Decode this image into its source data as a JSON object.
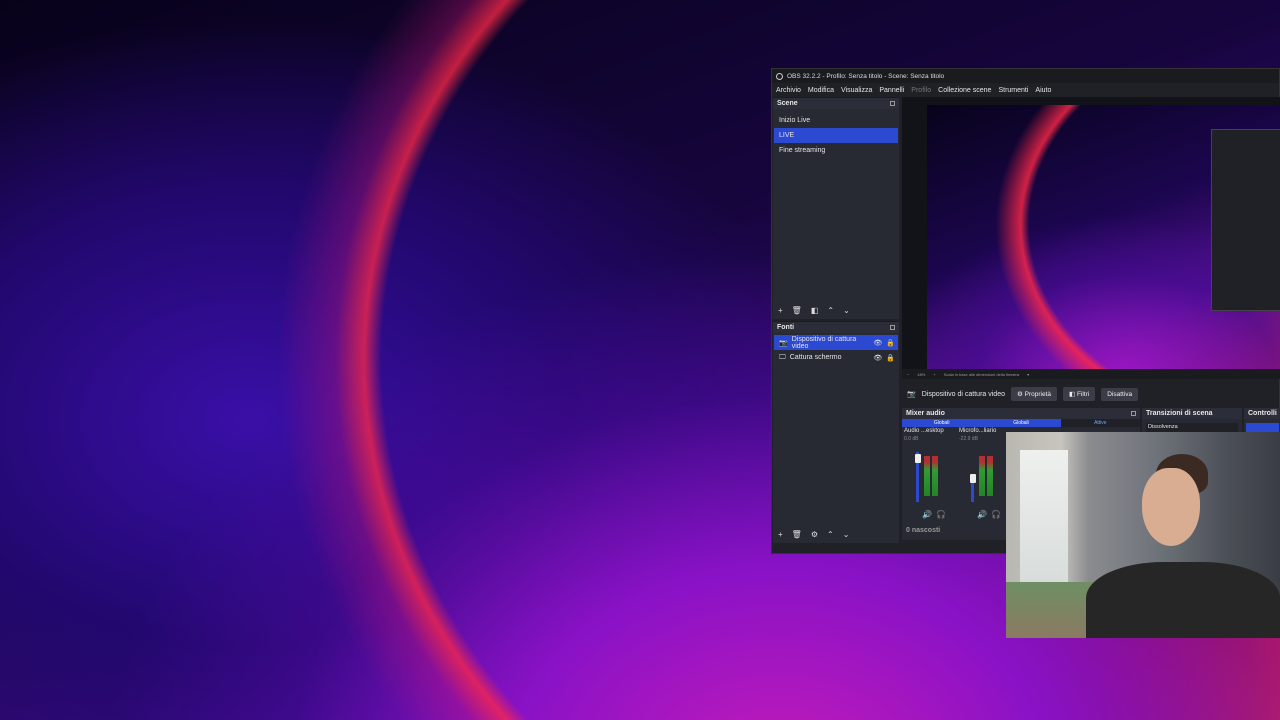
{
  "window": {
    "title": "OBS 32.2.2 - Profilo: Senza titolo - Scene: Senza titolo"
  },
  "menu": [
    "Archivio",
    "Modifica",
    "Visualizza",
    "Pannelli",
    "Profilo",
    "Collezione scene",
    "Strumenti",
    "Aiuto"
  ],
  "scenes": {
    "title": "Scene",
    "items": [
      "Inizio Live",
      "LIVE",
      "Fine streaming"
    ],
    "selected": "LIVE"
  },
  "sources": {
    "title": "Fonti",
    "items": [
      "Dispositivo di cattura video",
      "Cattura schermo"
    ],
    "selected": "Dispositivo di cattura video"
  },
  "zoom": {
    "value": "48%",
    "label": "Scala in base alle dimensioni della finestra"
  },
  "context": {
    "source": "Dispositivo di cattura video",
    "properties": "Proprietà",
    "filters": "Filtri",
    "deactivate": "Disattiva"
  },
  "mixer": {
    "title": "Mixer audio",
    "tabs": [
      "Globali",
      "Globali",
      "Attive"
    ],
    "channels": [
      {
        "name": "Audio ...esktop",
        "db": "0.0 dB",
        "level": 0.95
      },
      {
        "name": "Microfo...liario",
        "db": "-22.9 dB",
        "level": 0.45
      }
    ],
    "hidden": "0 nascosti"
  },
  "transitions": {
    "title": "Transizioni di scena",
    "selected": "Dissolvenza"
  },
  "controls": {
    "title": "Controlli"
  }
}
